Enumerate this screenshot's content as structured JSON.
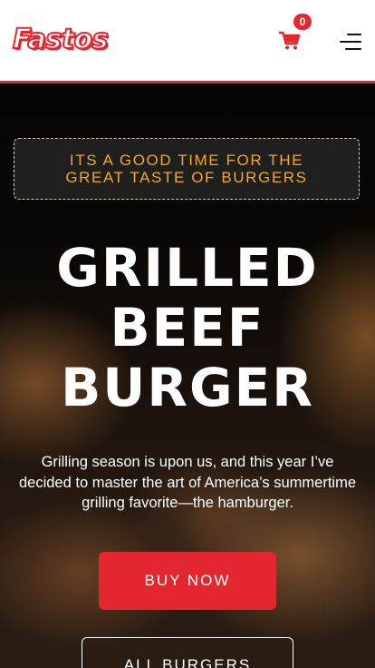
{
  "header": {
    "logo_text": "Fastos",
    "cart_count": "0",
    "cart_icon": "shopping-cart-icon",
    "menu_icon": "hamburger-menu-icon"
  },
  "hero": {
    "tagline": "ITS A GOOD TIME FOR THE GREAT TASTE OF BURGERS",
    "title_line1": "GRILLED",
    "title_line2": "BEEF",
    "title_line3": "BURGER",
    "description": "Grilling season is upon us, and this year I’ve decided to master the art of America’s summertime grilling favorite—the hamburger.",
    "buy_label": "BUY NOW",
    "all_label": "ALL BURGERS"
  },
  "colors": {
    "accent": "#e3262f",
    "tagline": "#f5a623",
    "header_bg": "#ffffff"
  }
}
